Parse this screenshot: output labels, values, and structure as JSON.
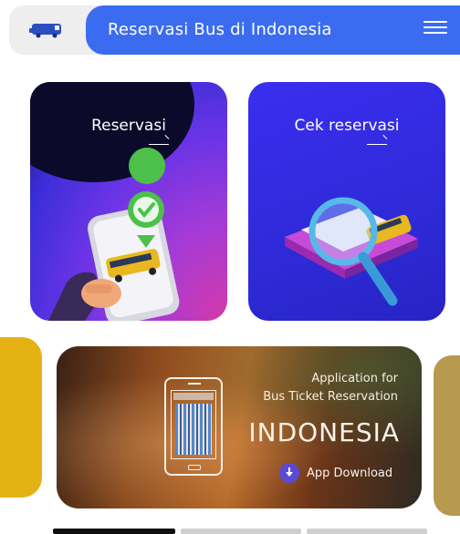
{
  "header": {
    "logo_icon": "bus-icon",
    "title": "Reservasi Bus di Indonesia",
    "menu_icon": "hamburger-menu-icon",
    "accent_color": "#3b6cf0"
  },
  "cards": [
    {
      "label": "Reservasi",
      "icon": "arrow-right-icon",
      "illustration": "phone-checkmark-bus-illustration"
    },
    {
      "label": "Cek reservasi",
      "icon": "arrow-right-icon",
      "illustration": "magnifier-bus-ticket-illustration"
    }
  ],
  "banner": {
    "subtitle_line1": "Application for",
    "subtitle_line2": "Bus Ticket Reservation",
    "country": "INDONESIA",
    "download_label": "App Download",
    "download_icon": "download-icon"
  },
  "carousel": {
    "slide_count": 3,
    "active_index": 0
  }
}
